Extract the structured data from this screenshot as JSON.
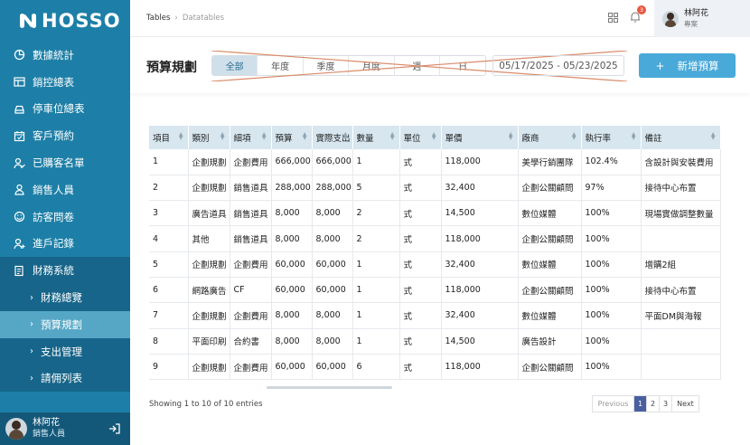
{
  "app": {
    "logo_text": "HOSSO"
  },
  "sidebar": {
    "items": [
      {
        "label": "數據統計",
        "icon": "pie-chart-icon"
      },
      {
        "label": "銷控總表",
        "icon": "table-icon"
      },
      {
        "label": "停車位總表",
        "icon": "car-icon"
      },
      {
        "label": "客戶預約",
        "icon": "calendar-icon"
      },
      {
        "label": "已購客名單",
        "icon": "user-check-icon"
      },
      {
        "label": "銷售人員",
        "icon": "user-icon"
      },
      {
        "label": "訪客問卷",
        "icon": "smile-icon"
      },
      {
        "label": "進戶記錄",
        "icon": "user-add-icon"
      },
      {
        "label": "財務系統",
        "icon": "document-icon"
      }
    ],
    "sub_items": [
      {
        "label": "財務總覽"
      },
      {
        "label": "預算規劃"
      },
      {
        "label": "支出管理"
      },
      {
        "label": "請佣列表"
      }
    ],
    "footer": {
      "name": "林阿花",
      "role": "銷售人員"
    }
  },
  "header": {
    "breadcrumb_root": "Tables",
    "breadcrumb_current": "Datatables",
    "notification_count": "3",
    "user_name": "林阿花",
    "user_role": "專案"
  },
  "toolbar": {
    "title": "預算規劃",
    "tabs": [
      "全部",
      "年度",
      "季度",
      "月度",
      "週",
      "日"
    ],
    "date_range": "05/17/2025 - 05/23/2025",
    "add_label": "新增預算"
  },
  "table": {
    "columns": [
      "項目",
      "類別",
      "細項",
      "預算",
      "實際支出",
      "數量",
      "單位",
      "單價",
      "廠商",
      "執行率",
      "備註"
    ],
    "rows": [
      [
        "1",
        "企劃規劃",
        "企劃費用",
        "666,000",
        "666,000",
        "1",
        "式",
        "118,000",
        "美學行銷團隊",
        "102.4%",
        "含設計與安裝費用"
      ],
      [
        "2",
        "企劃規劃",
        "銷售道具",
        "288,000",
        "288,000",
        "5",
        "式",
        "32,400",
        "企劃公關顧問",
        "97%",
        "接待中心布置"
      ],
      [
        "3",
        "廣告道具",
        "銷售道具",
        "8,000",
        "8,000",
        "2",
        "式",
        "14,500",
        "數位媒體",
        "100%",
        "現場實做調整數量"
      ],
      [
        "4",
        "其他",
        "銷售道具",
        "8,000",
        "8,000",
        "2",
        "式",
        "118,000",
        "企劃公關顧問",
        "100%",
        ""
      ],
      [
        "5",
        "企劃規劃",
        "企劃費用",
        "60,000",
        "60,000",
        "1",
        "式",
        "32,400",
        "數位媒體",
        "100%",
        "增購2組"
      ],
      [
        "6",
        "網路廣告",
        "CF",
        "60,000",
        "60,000",
        "1",
        "式",
        "118,000",
        "企劃公關顧問",
        "100%",
        "接待中心布置"
      ],
      [
        "7",
        "企劃規劃",
        "企劃費用",
        "8,000",
        "8,000",
        "1",
        "式",
        "32,400",
        "數位媒體",
        "100%",
        "平面DM與海報"
      ],
      [
        "8",
        "平面印刷",
        "合約書",
        "8,000",
        "8,000",
        "1",
        "式",
        "14,500",
        "廣告設計",
        "100%",
        ""
      ],
      [
        "9",
        "企劃規劃",
        "企劃費用",
        "60,000",
        "60,000",
        "6",
        "式",
        "118,000",
        "企劃公關顧問",
        "100%",
        ""
      ]
    ],
    "showing": "Showing 1 to 10 of 10 entries",
    "pager": {
      "prev": "Previous",
      "pages": [
        "1",
        "2",
        "3"
      ],
      "next": "Next"
    }
  }
}
